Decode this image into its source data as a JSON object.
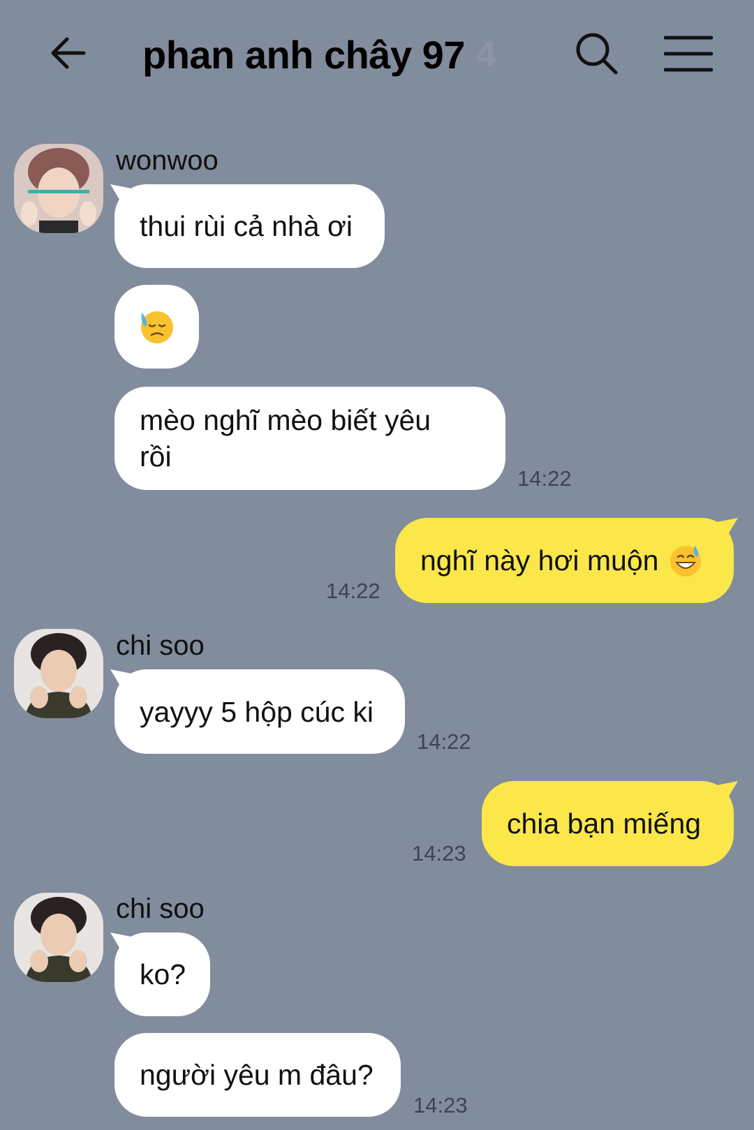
{
  "header": {
    "title": "phan anh chây 97",
    "member_count": "4",
    "icons": [
      "back-arrow-icon",
      "search-icon",
      "menu-icon"
    ]
  },
  "messages": [
    {
      "sender": "wonwoo",
      "side": "left",
      "text": "thui rùi cả nhà ơi"
    },
    {
      "side": "left",
      "emoji": "downcast-sweat-face"
    },
    {
      "side": "left",
      "line1": "mèo nghĩ mèo biết yêu",
      "line2": "rồi",
      "time": "14:22"
    },
    {
      "side": "right",
      "text": "nghĩ này hơi muộn",
      "emoji": "grinning-sweat-face",
      "time": "14:22"
    },
    {
      "sender": "chi soo",
      "side": "left",
      "text": "yayyy 5 hộp cúc ki",
      "time": "14:22"
    },
    {
      "side": "right",
      "text": "chia bạn miếng",
      "time": "14:23"
    },
    {
      "sender": "chi soo",
      "side": "left",
      "text": "ko?"
    },
    {
      "side": "left",
      "text": "người yêu m đâu?",
      "time": "14:23"
    }
  ],
  "colors": {
    "background": "#818c9d",
    "incoming_bubble": "#ffffff",
    "outgoing_bubble": "#fbe74a",
    "member_count": "#8a95a5"
  }
}
